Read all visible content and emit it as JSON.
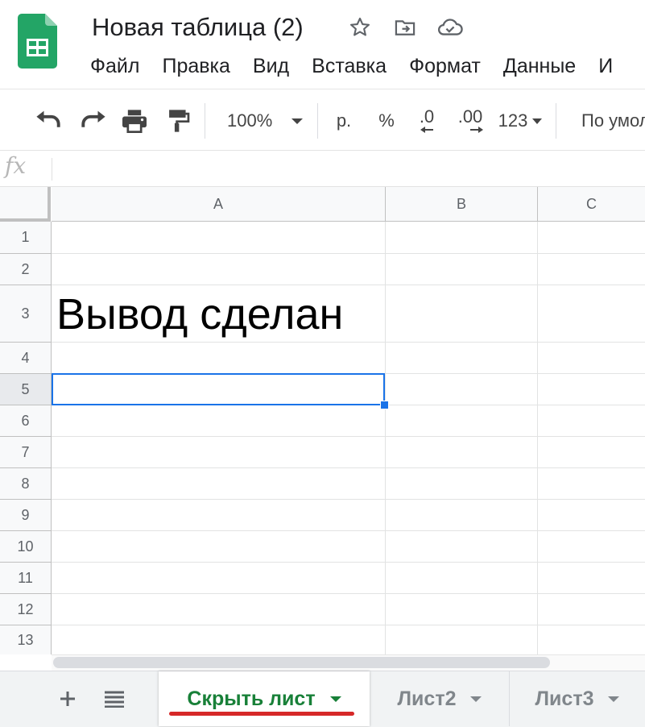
{
  "header": {
    "title": "Новая таблица (2)",
    "icons": [
      "sheets-logo-icon",
      "star-icon",
      "move-to-folder-icon",
      "cloud-status-icon"
    ]
  },
  "menu": [
    "Файл",
    "Правка",
    "Вид",
    "Вставка",
    "Формат",
    "Данные",
    "И"
  ],
  "toolbar": {
    "zoom": "100%",
    "currency": "р.",
    "percent": "%",
    "decrease_decimals": ".0",
    "increase_decimals": ".00",
    "more_formats": "123",
    "font": "По умол",
    "icons": [
      "undo-icon",
      "redo-icon",
      "print-icon",
      "paint-format-icon"
    ]
  },
  "formula_bar": {
    "fx": "fx",
    "value": ""
  },
  "grid": {
    "columns": [
      "A",
      "B",
      "C"
    ],
    "rows": [
      "1",
      "2",
      "3",
      "4",
      "5",
      "6",
      "7",
      "8",
      "9",
      "10",
      "11",
      "12",
      "13"
    ],
    "cells": {
      "A3": "Вывод сделан"
    },
    "selected_cell": "A5"
  },
  "sheets": {
    "active": "Скрыть лист",
    "tabs": [
      "Скрыть лист",
      "Лист2",
      "Лист3"
    ],
    "add_icon": "plus-icon",
    "list_icon": "all-sheets-icon"
  },
  "colors": {
    "accent": "#1a73e8",
    "sheets_green": "#188038",
    "logo_green": "#23a566",
    "annotation_red": "#d62828"
  }
}
